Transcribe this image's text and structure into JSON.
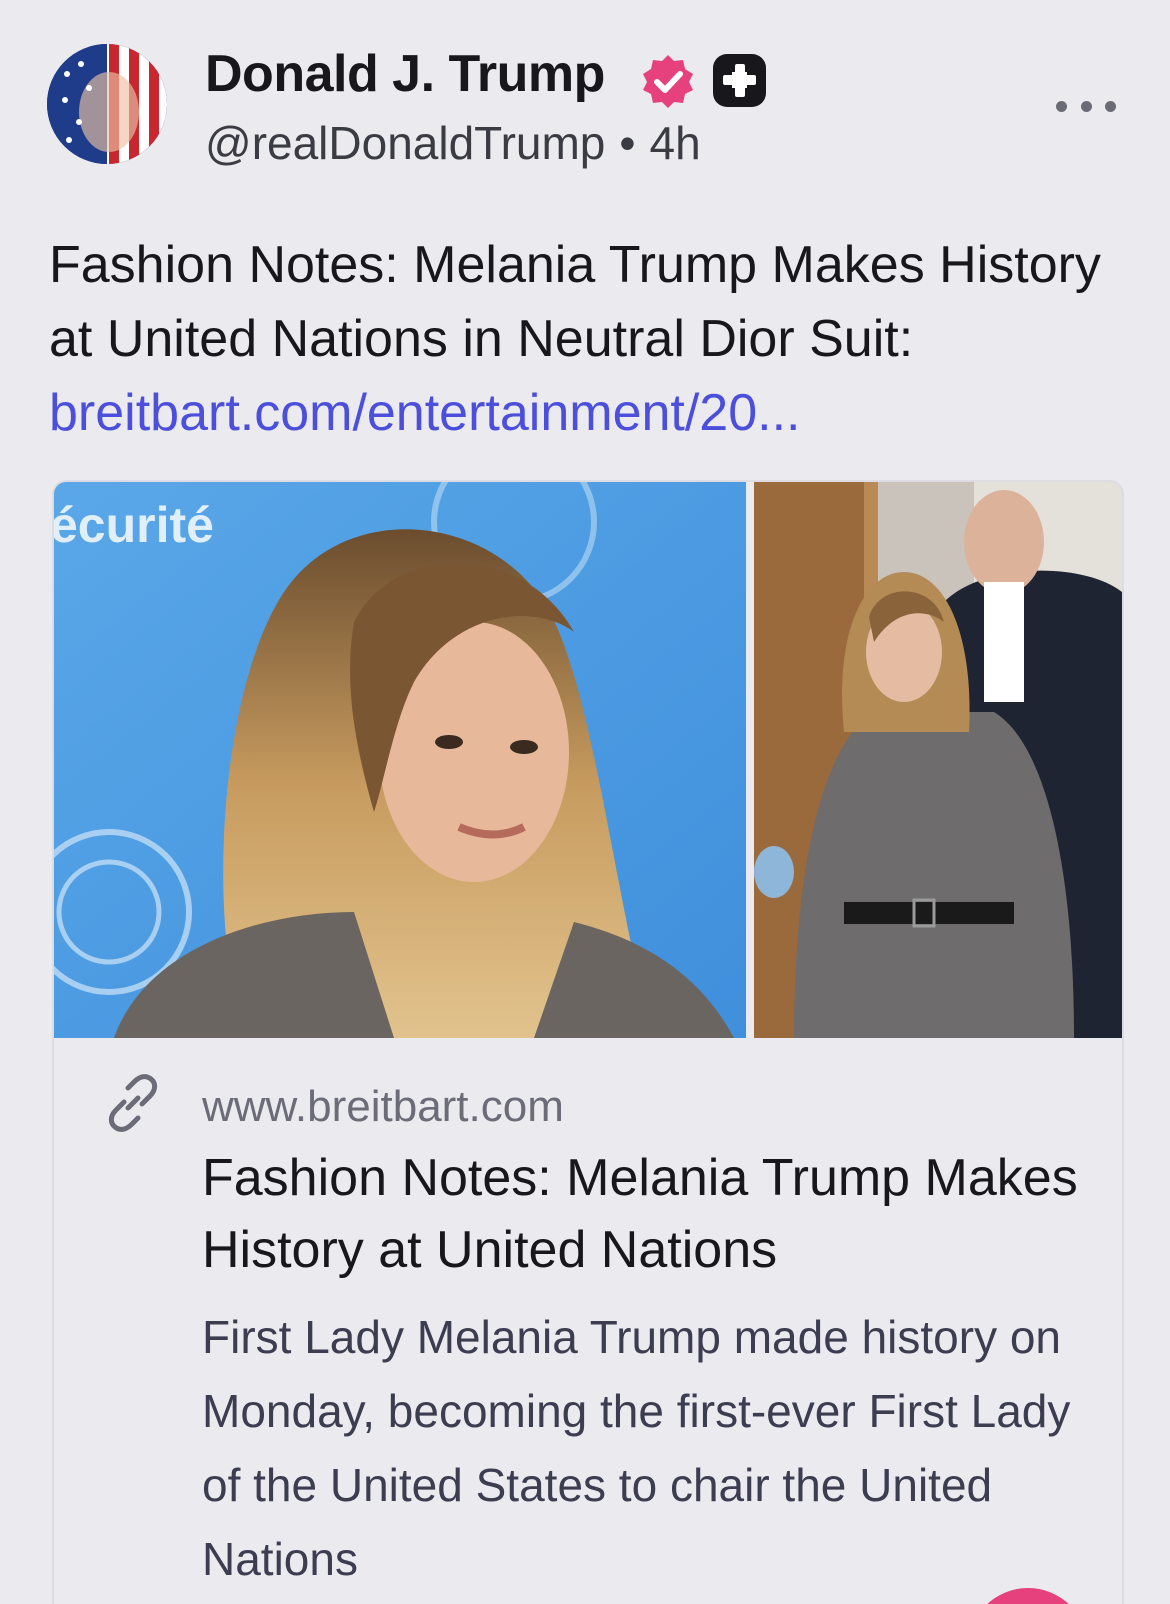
{
  "author": {
    "name": "Donald J. Trump",
    "handle": "@realDonaldTrump",
    "separator": "•",
    "time": "4h",
    "verified_icon": "verified-badge-icon",
    "plus_icon": "plus-badge-icon",
    "avatar_icon": "avatar-image"
  },
  "post": {
    "text": "Fashion Notes: Melania Trump Makes History at United Nations in Neutral Dior Suit: ",
    "link_text": "breitbart.com/entertainment/20..."
  },
  "card": {
    "image_left_text": "écurité",
    "domain": "www.breitbart.com",
    "title": "Fashion Notes: Melania Trump Makes History at United Nations",
    "description": "First Lady Melania Trump made history on Monday, becoming the first-ever First Lady of the United States to chair the United Nations"
  },
  "colors": {
    "background": "#ebebef",
    "link": "#4b4fdc",
    "verified": "#e6407d",
    "text": "#17171c",
    "muted": "#6c6c78"
  }
}
